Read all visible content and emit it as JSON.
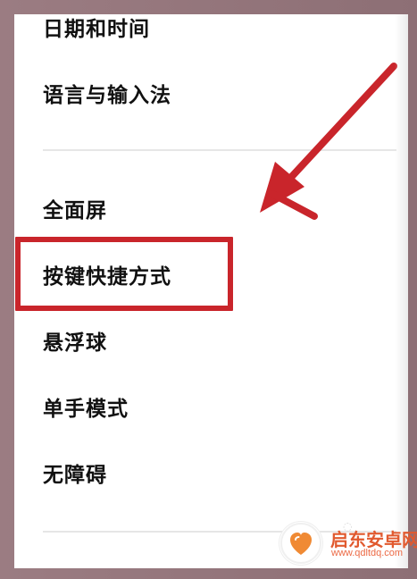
{
  "menu": {
    "items": [
      {
        "label": "日期和时间"
      },
      {
        "label": "语言与输入法"
      },
      {
        "label": "全面屏"
      },
      {
        "label": "按键快捷方式"
      },
      {
        "label": "悬浮球"
      },
      {
        "label": "单手模式"
      },
      {
        "label": "无障碍"
      }
    ]
  },
  "annotation": {
    "highlight_color": "#c9252b",
    "arrow_color": "#c9252b",
    "highlighted_item": "按键快捷方式"
  },
  "watermark": {
    "title": "启东安卓网",
    "url": "www.qdltdq.com",
    "logo_icon": "orange-heart-logo"
  }
}
